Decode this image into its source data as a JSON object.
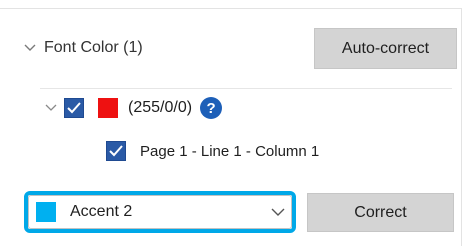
{
  "section": {
    "title": "Font Color (1)",
    "expanded_icon": "chevron-down-icon"
  },
  "buttons": {
    "autocorrect_label": "Auto-correct",
    "correct_label": "Correct"
  },
  "color_item": {
    "checked": true,
    "swatch_color": "#ee1111",
    "value": "(255/0/0)",
    "help_icon_glyph": "?"
  },
  "location_item": {
    "checked": true,
    "text": "Page 1 - Line 1 - Column 1"
  },
  "replacement": {
    "selected_label": "Accent 2",
    "selected_swatch_color": "#00b0f0"
  },
  "colors": {
    "checkbox_fill": "#2a5aa6",
    "focus_ring": "#00a8e8",
    "help_icon": "#1d5fb8",
    "button_bg": "#d4d4d4"
  }
}
